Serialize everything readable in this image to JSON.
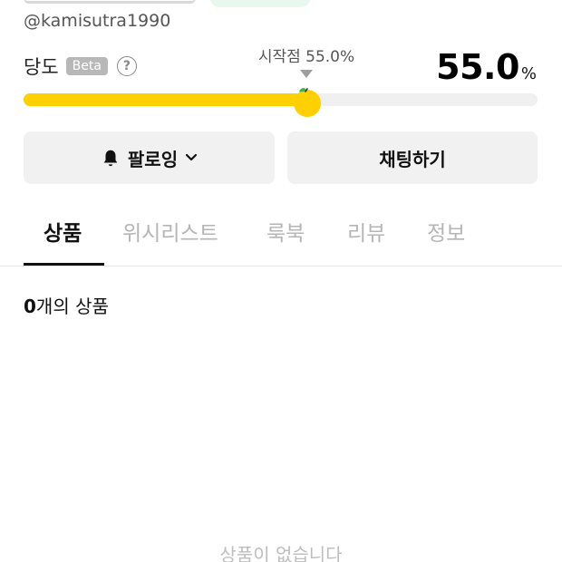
{
  "profile": {
    "handle": "@kamisutra1990"
  },
  "trust": {
    "label": "당도",
    "beta_badge": "Beta",
    "help_icon_text": "?",
    "start_label": "시작점 55.0%",
    "value": "55.0",
    "unit": "%",
    "level_percent": 55.0,
    "colors": {
      "fill": "#ffd000",
      "track": "#f0f0f0"
    }
  },
  "actions": {
    "follow_label": "팔로잉",
    "chat_label": "채팅하기"
  },
  "icons": {
    "follow": "bell-icon",
    "follow_menu": "chevron-down-icon",
    "help": "question-circle-icon",
    "trust_marker": "lemon-icon"
  },
  "tabs": [
    {
      "label": "상품",
      "active": true
    },
    {
      "label": "위시리스트",
      "active": false
    },
    {
      "label": "룩북",
      "active": false
    },
    {
      "label": "리뷰",
      "active": false
    },
    {
      "label": "정보",
      "active": false
    }
  ],
  "products": {
    "count": "0",
    "count_suffix": "개의 상품",
    "empty_text": "상품이 없습니다"
  }
}
